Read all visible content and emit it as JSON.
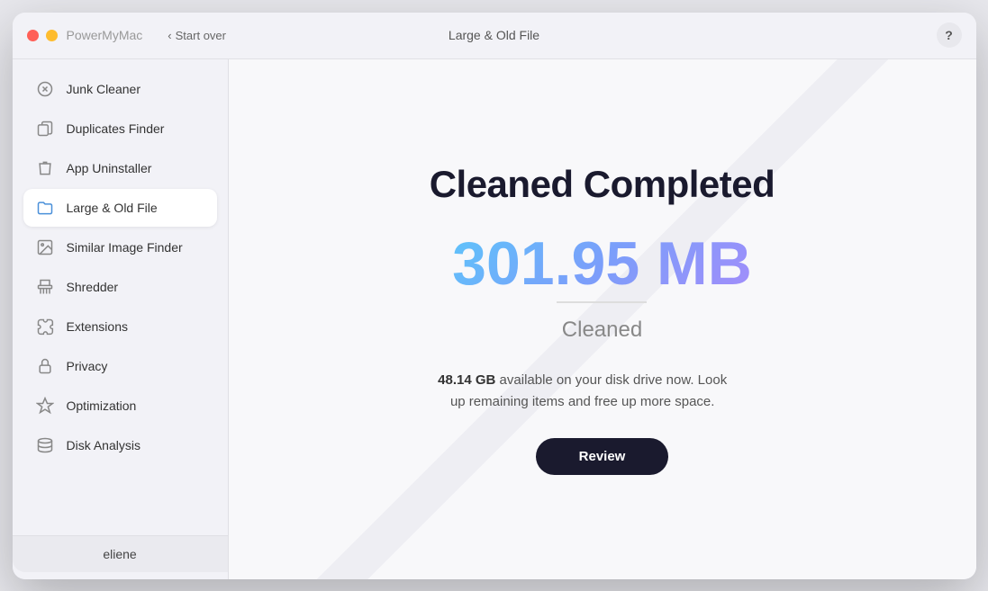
{
  "window": {
    "title": "PowerMyMac",
    "page_title": "Large & Old File"
  },
  "titlebar": {
    "app_name": "PowerMyMac",
    "start_over_label": "Start over",
    "help_label": "?"
  },
  "sidebar": {
    "items": [
      {
        "id": "junk-cleaner",
        "label": "Junk Cleaner",
        "icon": "broom",
        "active": false
      },
      {
        "id": "duplicates-finder",
        "label": "Duplicates Finder",
        "icon": "duplicate",
        "active": false
      },
      {
        "id": "app-uninstaller",
        "label": "App Uninstaller",
        "icon": "uninstall",
        "active": false
      },
      {
        "id": "large-old-file",
        "label": "Large & Old File",
        "icon": "folder",
        "active": true
      },
      {
        "id": "similar-image-finder",
        "label": "Similar Image Finder",
        "icon": "image",
        "active": false
      },
      {
        "id": "shredder",
        "label": "Shredder",
        "icon": "shredder",
        "active": false
      },
      {
        "id": "extensions",
        "label": "Extensions",
        "icon": "extensions",
        "active": false
      },
      {
        "id": "privacy",
        "label": "Privacy",
        "icon": "privacy",
        "active": false
      },
      {
        "id": "optimization",
        "label": "Optimization",
        "icon": "optimization",
        "active": false
      },
      {
        "id": "disk-analysis",
        "label": "Disk Analysis",
        "icon": "disk",
        "active": false
      }
    ],
    "user": {
      "name": "eliene"
    }
  },
  "content": {
    "heading": "Cleaned Completed",
    "amount": "301.95 MB",
    "cleaned_label": "Cleaned",
    "available_gb": "48.14 GB",
    "available_text": " available on your disk drive now. Look up remaining items and free up more space.",
    "review_button_label": "Review"
  }
}
